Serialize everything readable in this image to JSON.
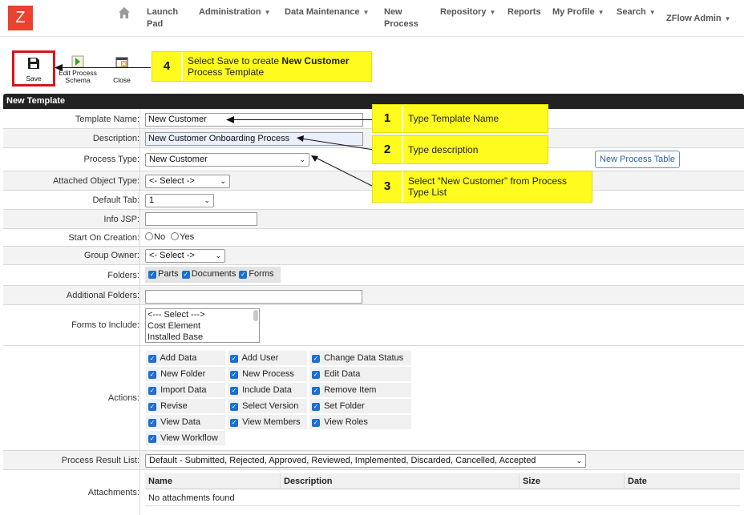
{
  "app": {
    "logo_letter": "Z"
  },
  "nav": {
    "items": [
      {
        "label": "Launch\nPad"
      },
      {
        "label": "Administration"
      },
      {
        "label": "Data Maintenance"
      },
      {
        "label": "New\nProcess"
      },
      {
        "label": "Repository"
      },
      {
        "label": "Reports"
      },
      {
        "label": "My Profile"
      },
      {
        "label": "Search"
      },
      {
        "label": "ZFlow Admin"
      }
    ]
  },
  "toolbar": {
    "save_label": "Save",
    "edit_schema_label": "Edit Process\nSchema",
    "close_label": "Close"
  },
  "callouts": [
    {
      "num": "4",
      "text_pre": "Select Save to create ",
      "text_bold": "New Customer",
      "text_post": " Process Template"
    },
    {
      "num": "1",
      "text": "Type Template Name"
    },
    {
      "num": "2",
      "text": "Type description"
    },
    {
      "num": "3",
      "text": "Select “New Customer” from Process Type List"
    }
  ],
  "form": {
    "title": "New Template",
    "template_name": {
      "label": "Template Name:",
      "value": "New Customer"
    },
    "description": {
      "label": "Description:",
      "value": "New Customer Onboarding Process"
    },
    "process_type": {
      "label": "Process Type:",
      "value": "New Customer",
      "button": "New Process Table"
    },
    "attached_object_type": {
      "label": "Attached Object Type:",
      "value": "<- Select ->"
    },
    "default_tab": {
      "label": "Default Tab:",
      "value": "1"
    },
    "info_jsp": {
      "label": "Info JSP:",
      "value": ""
    },
    "start_on_creation": {
      "label": "Start On Creation:",
      "no": "No",
      "yes": "Yes"
    },
    "group_owner": {
      "label": "Group Owner:",
      "value": "<- Select ->"
    },
    "folders": {
      "label": "Folders:",
      "items": [
        "Parts",
        "Documents",
        "Forms"
      ]
    },
    "additional_folders": {
      "label": "Additional Folders:",
      "value": ""
    },
    "forms_to_include": {
      "label": "Forms to Include:",
      "options": [
        "<--- Select --->",
        "Cost Element",
        "Installed Base"
      ]
    },
    "actions": {
      "label": "Actions:",
      "items": [
        "Add Data",
        "Add User",
        "Change Data Status",
        "New Folder",
        "New Process",
        "Edit Data",
        "Import Data",
        "Include Data",
        "Remove Item",
        "Revise",
        "Select Version",
        "Set Folder",
        "View Data",
        "View Members",
        "View Roles",
        "View Workflow"
      ]
    },
    "process_result_list": {
      "label": "Process Result List:",
      "value": "Default - Submitted, Rejected, Approved, Reviewed, Implemented, Discarded, Cancelled, Accepted"
    },
    "attachments": {
      "label": "Attachments:",
      "columns": [
        "Name",
        "Description",
        "Size",
        "Date"
      ],
      "empty": "No attachments found"
    }
  }
}
